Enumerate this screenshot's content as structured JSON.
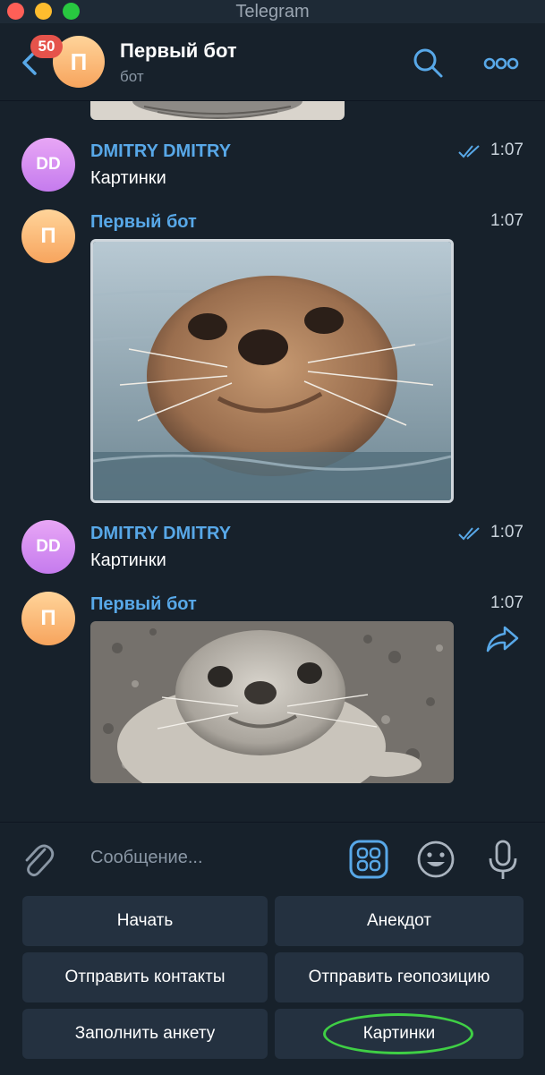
{
  "window": {
    "title": "Telegram"
  },
  "header": {
    "unread_count": "50",
    "avatar_letter": "П",
    "title": "Первый бот",
    "subtitle": "бот"
  },
  "messages": [
    {
      "sender": "DMITRY DMITRY",
      "avatar": "DD",
      "text": "Картинки",
      "time": "1:07",
      "status": "read"
    },
    {
      "sender": "Первый бот",
      "avatar": "П",
      "time": "1:07",
      "image": "seal swimming in water"
    },
    {
      "sender": "DMITRY DMITRY",
      "avatar": "DD",
      "text": "Картинки",
      "time": "1:07",
      "status": "read"
    },
    {
      "sender": "Первый бот",
      "avatar": "П",
      "time": "1:07",
      "image": "seal lying on pebble beach"
    }
  ],
  "composer": {
    "placeholder": "Сообщение..."
  },
  "keyboard": {
    "rows": [
      [
        "Начать",
        "Анекдот"
      ],
      [
        "Отправить контакты",
        "Отправить геопозицию"
      ],
      [
        "Заполнить анкету",
        "Картинки"
      ]
    ]
  },
  "colors": {
    "background": "#17212b",
    "accent": "#58a8e8",
    "button": "#243140",
    "highlight_oval": "#3fcf45"
  },
  "icons": [
    "back-arrow-icon",
    "search-icon",
    "more-icon",
    "double-check-icon",
    "forward-icon",
    "paperclip-icon",
    "bot-keyboard-icon",
    "emoji-icon",
    "microphone-icon"
  ]
}
